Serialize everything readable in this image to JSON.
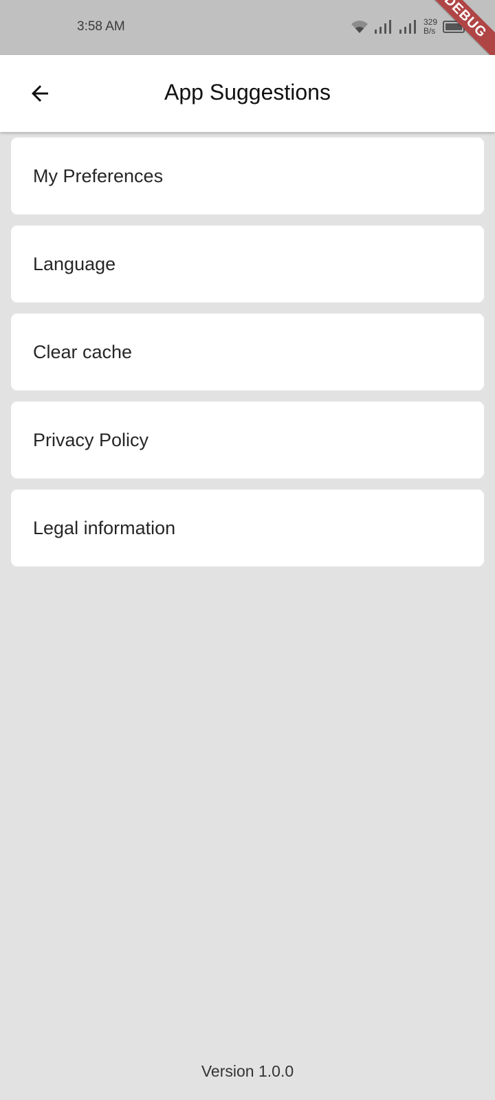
{
  "status_bar": {
    "time": "3:58 AM",
    "net_speed_value": "329",
    "net_speed_unit": "B/s",
    "icons": [
      "wifi-icon",
      "signal-icon",
      "signal-icon",
      "battery-icon"
    ]
  },
  "debug_banner": "DEBUG",
  "app_bar": {
    "title": "App Suggestions",
    "back_icon": "arrow-back-icon"
  },
  "menu": {
    "items": [
      {
        "label": "My Preferences"
      },
      {
        "label": "Language"
      },
      {
        "label": "Clear cache"
      },
      {
        "label": "Privacy Policy"
      },
      {
        "label": "Legal information"
      }
    ]
  },
  "footer": {
    "version": "Version 1.0.0"
  },
  "colors": {
    "status_bar_bg": "#c0c0c0",
    "background": "#e2e2e2",
    "card_bg": "#ffffff",
    "debug_ribbon": "#b04545"
  }
}
